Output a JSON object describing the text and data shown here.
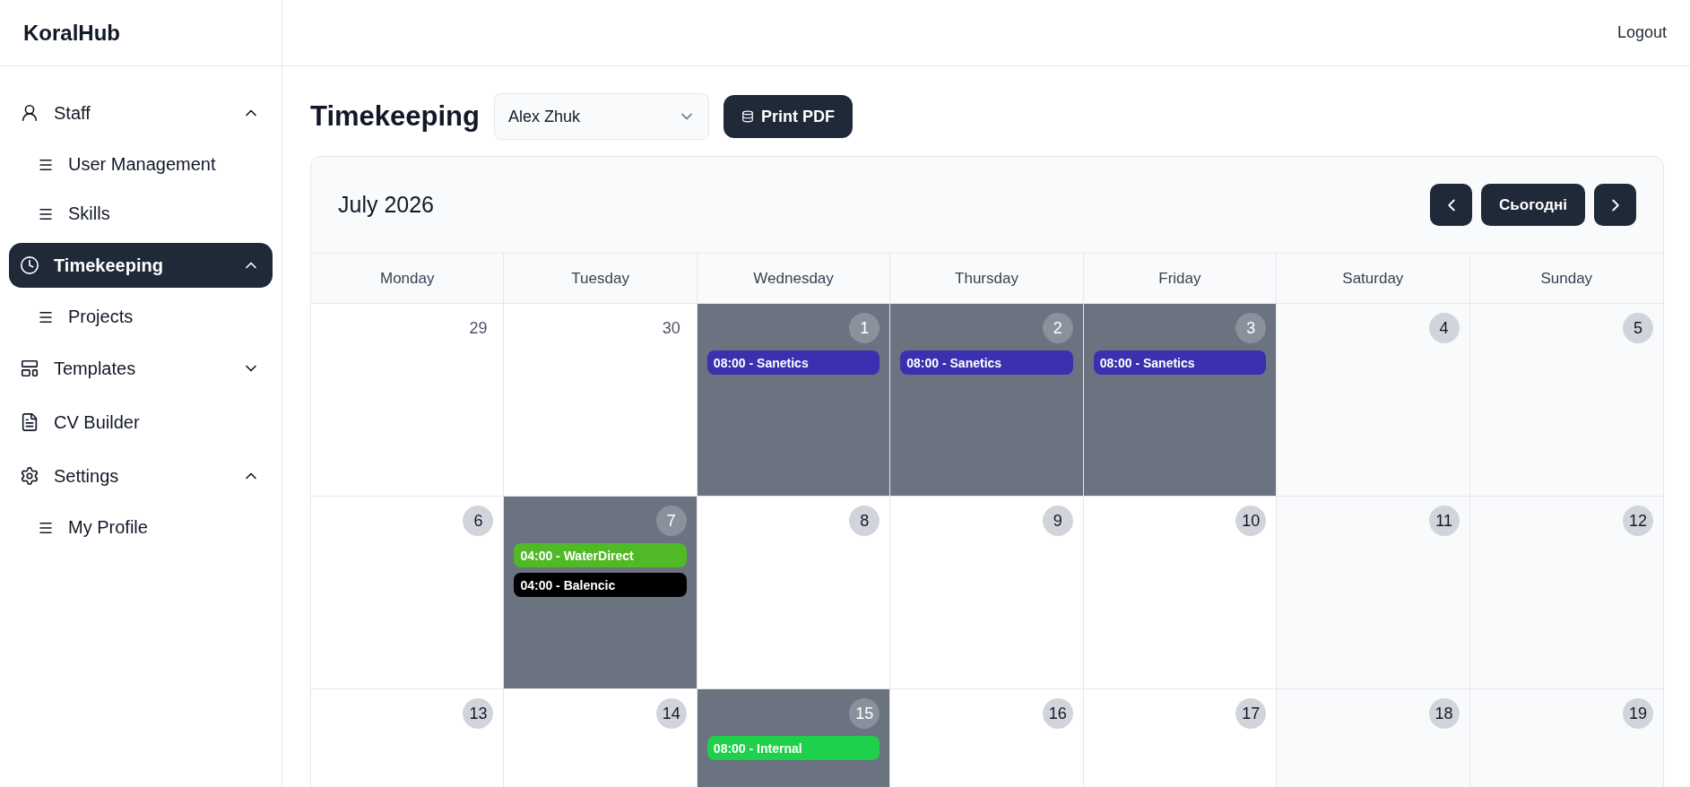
{
  "brand": "KoralHub",
  "header": {
    "logout": "Logout"
  },
  "sidebar": {
    "items": [
      {
        "kind": "group",
        "label": "Staff",
        "selected": false,
        "expanded": true,
        "children": [
          {
            "label": "User Management",
            "selected": false
          },
          {
            "label": "Skills",
            "selected": false
          }
        ]
      },
      {
        "kind": "group",
        "label": "Timekeeping",
        "selected": true,
        "expanded": true,
        "children": [
          {
            "label": "Projects",
            "selected": false
          }
        ]
      },
      {
        "kind": "group",
        "label": "Templates",
        "selected": false,
        "expanded": false
      },
      {
        "kind": "link",
        "label": "CV Builder",
        "selected": false
      },
      {
        "kind": "group",
        "label": "Settings",
        "selected": false,
        "expanded": true,
        "children": [
          {
            "label": "My Profile",
            "selected": false
          }
        ]
      }
    ]
  },
  "page": {
    "title": "Timekeeping",
    "user_select": {
      "value": "Alex Zhuk"
    },
    "print_button": "Print PDF"
  },
  "calendar": {
    "month": "July 2026",
    "today_button": "Сьогодні",
    "weekdays": [
      "Monday",
      "Tuesday",
      "Wednesday",
      "Thursday",
      "Friday",
      "Saturday",
      "Sunday"
    ],
    "weeks": [
      [
        {
          "number": "29",
          "outside_month": true,
          "filled": false
        },
        {
          "number": "30",
          "outside_month": true,
          "filled": false
        },
        {
          "number": "1",
          "outside_month": false,
          "filled": true,
          "entries": [
            {
              "label": "08:00 - Sanetics",
              "color": "#3a30b0"
            }
          ]
        },
        {
          "number": "2",
          "outside_month": false,
          "filled": true,
          "entries": [
            {
              "label": "08:00 - Sanetics",
              "color": "#3a30b0"
            }
          ]
        },
        {
          "number": "3",
          "outside_month": false,
          "filled": true,
          "entries": [
            {
              "label": "08:00 - Sanetics",
              "color": "#3a30b0"
            }
          ]
        },
        {
          "number": "4",
          "outside_month": false,
          "filled": false
        },
        {
          "number": "5",
          "outside_month": false,
          "filled": false
        }
      ],
      [
        {
          "number": "6",
          "outside_month": false,
          "filled": false
        },
        {
          "number": "7",
          "outside_month": false,
          "filled": true,
          "entries": [
            {
              "label": "04:00 - WaterDirect",
              "color": "#4fba26"
            },
            {
              "label": "04:00 - Balencic",
              "color": "#000000"
            }
          ]
        },
        {
          "number": "8",
          "outside_month": false,
          "filled": false
        },
        {
          "number": "9",
          "outside_month": false,
          "filled": false
        },
        {
          "number": "10",
          "outside_month": false,
          "filled": false
        },
        {
          "number": "11",
          "outside_month": false,
          "filled": false
        },
        {
          "number": "12",
          "outside_month": false,
          "filled": false
        }
      ],
      [
        {
          "number": "13",
          "outside_month": false,
          "filled": false
        },
        {
          "number": "14",
          "outside_month": false,
          "filled": false
        },
        {
          "number": "15",
          "outside_month": false,
          "filled": true,
          "entries": [
            {
              "label": "08:00 - Internal",
              "color": "#1fd14a"
            }
          ]
        },
        {
          "number": "16",
          "outside_month": false,
          "filled": false
        },
        {
          "number": "17",
          "outside_month": false,
          "filled": false
        },
        {
          "number": "18",
          "outside_month": false,
          "filled": false
        },
        {
          "number": "19",
          "outside_month": false,
          "filled": false
        }
      ]
    ]
  }
}
